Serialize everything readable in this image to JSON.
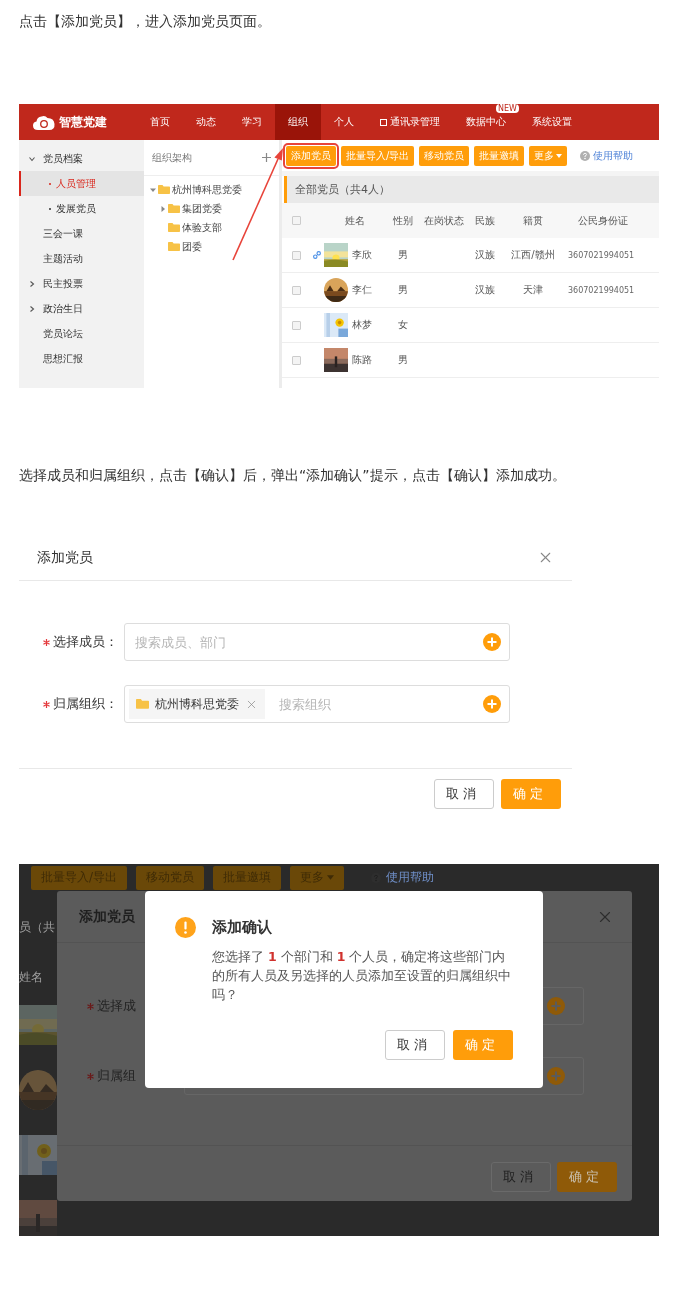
{
  "instruction_1": "点击【添加党员】，进入添加党员页面。",
  "screenshot_1": {
    "logo": "智慧党建",
    "nav": [
      {
        "label": "首页",
        "selected": false
      },
      {
        "label": "动态",
        "selected": false
      },
      {
        "label": "学习",
        "selected": false
      },
      {
        "label": "组织",
        "selected": true
      },
      {
        "label": "个人",
        "selected": false
      },
      {
        "label": "通讯录管理",
        "selected": false,
        "kind": "icon"
      },
      {
        "label": "数据中心",
        "selected": false,
        "badge": "NEW"
      },
      {
        "label": "系统设置",
        "selected": false
      }
    ],
    "sidebar": [
      {
        "label": "党员档案",
        "selected": false,
        "expanded": true,
        "children": [
          {
            "label": "人员管理",
            "selected": true
          },
          {
            "label": "发展党员",
            "selected": false
          }
        ]
      },
      {
        "label": "三会一课",
        "selected": false
      },
      {
        "label": "主题活动",
        "selected": false
      },
      {
        "label": "民主投票",
        "selected": false,
        "expanded": false
      },
      {
        "label": "政治生日",
        "selected": false,
        "expanded": false
      },
      {
        "label": "党员论坛",
        "selected": false
      },
      {
        "label": "思想汇报",
        "selected": false
      }
    ],
    "tree": {
      "title": "组织架构",
      "nodes": [
        {
          "label": "杭州博科思党委",
          "expanded": true,
          "children": [
            {
              "label": "集团党委",
              "expanded": false
            },
            {
              "label": "体验支部"
            },
            {
              "label": "团委"
            }
          ]
        }
      ]
    },
    "toolbar": [
      {
        "label": "添加党员",
        "highlighted": true
      },
      {
        "label": "批量导入/导出",
        "highlighted": false
      },
      {
        "label": "移动党员",
        "highlighted": false
      },
      {
        "label": "批量邀填",
        "highlighted": false
      },
      {
        "label": "更多",
        "highlighted": false,
        "kind": "dropdown"
      }
    ],
    "help": "使用帮助",
    "list_title": "全部党员（共4人）",
    "header_checked": false,
    "columns": [
      "姓名",
      "性别",
      "在岗状态",
      "民族",
      "籍贯",
      "公民身份证"
    ],
    "rows": [
      {
        "name": "李欣",
        "gender": "男",
        "ethnicity": "汉族",
        "hometown": "江西/赣州",
        "id_number": "3607021994051",
        "linked": true,
        "checked": false
      },
      {
        "name": "李仁",
        "gender": "男",
        "ethnicity": "汉族",
        "hometown": "天津",
        "id_number": "3607021994051",
        "linked": false,
        "checked": false
      },
      {
        "name": "林梦",
        "gender": "女",
        "linked": false,
        "checked": false
      },
      {
        "name": "陈路",
        "gender": "男",
        "linked": false,
        "checked": false
      }
    ]
  },
  "instruction_2": "选择成员和归属组织，点击【确认】后，弹出“添加确认”提示，点击【确认】添加成功。",
  "dialog": {
    "title": "添加党员",
    "fields": [
      {
        "label": "选择成员：",
        "required": true,
        "placeholder": "搜索成员、部门"
      },
      {
        "label": "归属组织：",
        "required": true,
        "placeholder": "搜索组织",
        "tags": [
          "杭州博科思党委"
        ]
      }
    ],
    "buttons": [
      {
        "label": "取消",
        "kind": "secondary"
      },
      {
        "label": "确定",
        "kind": "primary"
      }
    ]
  },
  "screenshot_2": {
    "background_toolbar": [
      "批量导入/导出",
      "移动党员",
      "批量邀填",
      "更多"
    ],
    "background_help": "使用帮助",
    "background_list_title": "员（共",
    "background_column": "姓名",
    "back_dialog": {
      "title": "添加党员",
      "fields": [
        {
          "label": "选择成",
          "required": true
        },
        {
          "label": "归属组",
          "required": true
        }
      ],
      "buttons": [
        {
          "label": "取消",
          "kind": "secondary"
        },
        {
          "label": "确定",
          "kind": "primary"
        }
      ]
    },
    "confirm": {
      "title": "添加确认",
      "message": "您选择了 **1** 个部门和 **1** 个人员，确定将这些部门内的所有人员及另选择的人员添加至设置的归属组织中吗？",
      "buttons": [
        {
          "label": "取消",
          "kind": "secondary"
        },
        {
          "label": "确定",
          "kind": "primary"
        }
      ]
    }
  }
}
